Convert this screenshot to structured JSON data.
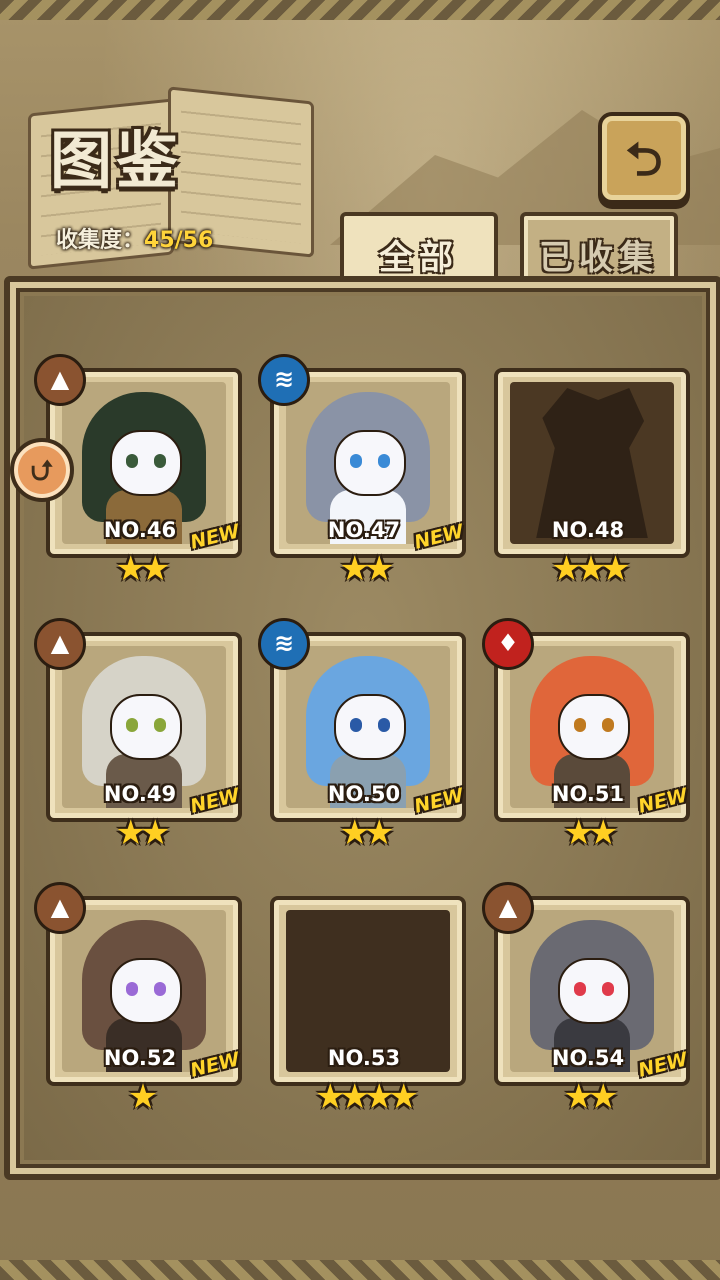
{
  "header": {
    "title": "图鉴",
    "progress_label": "收集度：",
    "progress_value": "45/56",
    "back_icon": "return-arrow-icon"
  },
  "tabs": [
    {
      "label": "全部",
      "active": true
    },
    {
      "label": "已收集",
      "active": false
    }
  ],
  "cards": [
    {
      "number": "NO.46",
      "element": "earth",
      "new": "NEW",
      "stars": "★★",
      "collected": true,
      "colors": {
        "hair": "#2a3a2a",
        "body": "#8b6a3a",
        "eye": "#3a5a3a"
      }
    },
    {
      "number": "NO.47",
      "element": "water",
      "new": "NEW",
      "stars": "★★",
      "collected": true,
      "colors": {
        "hair": "#8a93a6",
        "body": "#f3f6fb",
        "eye": "#3a8ad6"
      }
    },
    {
      "number": "NO.48",
      "element": "",
      "new": "",
      "stars": "★★★",
      "collected": false
    },
    {
      "number": "NO.49",
      "element": "earth",
      "new": "NEW",
      "stars": "★★",
      "collected": true,
      "colors": {
        "hair": "#d6d3c8",
        "body": "#6a5a4a",
        "eye": "#8aa63a"
      }
    },
    {
      "number": "NO.50",
      "element": "water",
      "new": "NEW",
      "stars": "★★",
      "collected": true,
      "colors": {
        "hair": "#6aa6e0",
        "body": "#8aa0b0",
        "eye": "#2a5aa6"
      }
    },
    {
      "number": "NO.51",
      "element": "fire",
      "new": "NEW",
      "stars": "★★",
      "collected": true,
      "colors": {
        "hair": "#e0663a",
        "body": "#5a4a3a",
        "eye": "#c07a20"
      }
    },
    {
      "number": "NO.52",
      "element": "earth",
      "new": "NEW",
      "stars": "★",
      "collected": true,
      "colors": {
        "hair": "#6a5040",
        "body": "#3a2e26",
        "eye": "#9a6ad6"
      }
    },
    {
      "number": "NO.53",
      "element": "",
      "new": "",
      "stars": "★★★★",
      "collected": false,
      "locked": true
    },
    {
      "number": "NO.54",
      "element": "earth",
      "new": "NEW",
      "stars": "★★",
      "collected": true,
      "colors": {
        "hair": "#6a6a72",
        "body": "#3a3a40",
        "eye": "#e03a4a"
      }
    }
  ],
  "element_icons": {
    "earth": "mountain-icon",
    "water": "waves-icon",
    "fire": "flame-icon"
  },
  "side_badge_icon": "arrow-badge-icon"
}
